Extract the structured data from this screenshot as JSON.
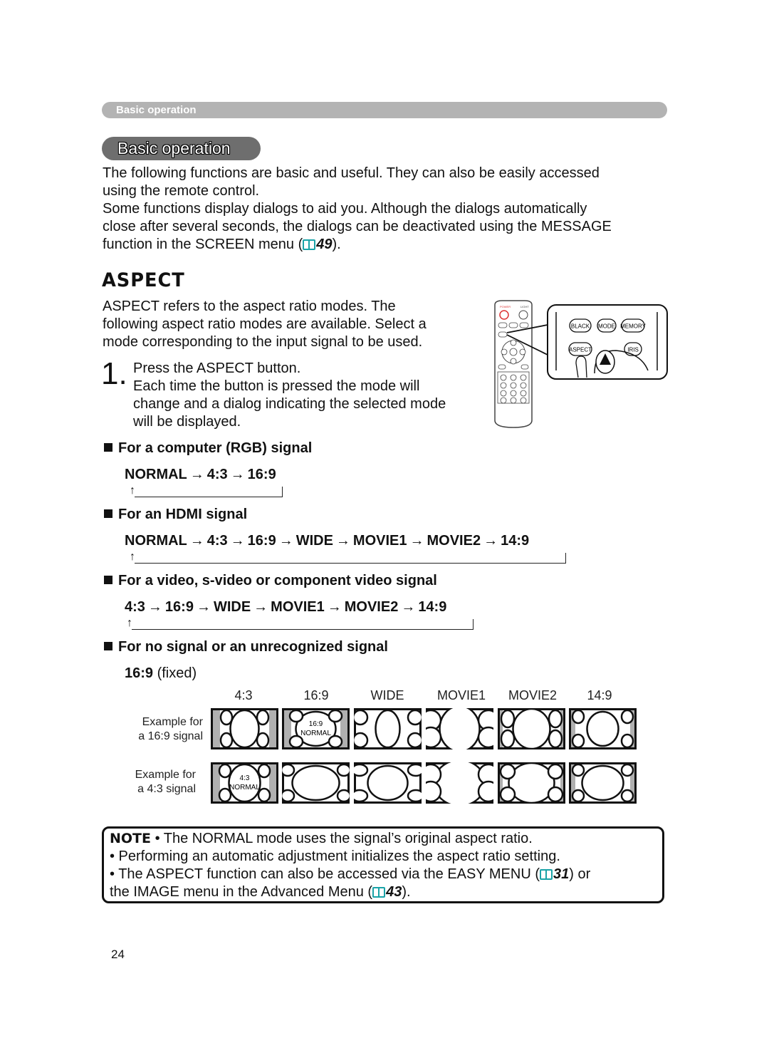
{
  "header": {
    "running_title": "Basic operation"
  },
  "section": {
    "title": "Basic operation",
    "intro_line1": "The following functions are basic and useful. They can also be easily accessed",
    "intro_line2": "using the remote control.",
    "intro_line3": "Some functions display dialogs to aid you. Although the dialogs automatically",
    "intro_line4": "close after several seconds, the dialogs can be deactivated using the MESSAGE",
    "intro_line5_prefix": "function in the SCREEN menu (",
    "intro_line5_ref": "49",
    "intro_line5_suffix": ")."
  },
  "aspect": {
    "heading": "ASPECT",
    "desc_line1": "ASPECT refers to the aspect ratio modes. The",
    "desc_line2": "following aspect ratio modes are available. Select a",
    "desc_line3": "mode corresponding to the input signal to be used.",
    "step_number": "1.",
    "step_line1": "Press the ASPECT button.",
    "step_line2": "Each time the button is pressed the mode will",
    "step_line3": "change and a dialog indicating the selected mode",
    "step_line4": "will be displayed."
  },
  "remote": {
    "power_label": "POWER",
    "light_label": "LIGHT",
    "callout_buttons": [
      "BLACK",
      "MODE",
      "MEMORY",
      "ASPECT",
      "IRIS"
    ]
  },
  "signals": [
    {
      "heading": "For a computer (RGB) signal",
      "sequence": [
        "NORMAL",
        "4:3",
        "16:9"
      ]
    },
    {
      "heading": "For an HDMI signal",
      "sequence": [
        "NORMAL",
        "4:3",
        "16:9",
        "WIDE",
        "MOVIE1",
        "MOVIE2",
        "14:9"
      ]
    },
    {
      "heading": "For a video, s-video or component video signal",
      "sequence": [
        "4:3",
        "16:9",
        "WIDE",
        "MOVIE1",
        "MOVIE2",
        "14:9"
      ]
    },
    {
      "heading": "For no signal or an unrecognized signal",
      "fixed_value": "16:9",
      "fixed_suffix": "(fixed)"
    }
  ],
  "arrow_glyph": "→",
  "loop_arrow_glyph": "↑",
  "examples": {
    "columns": [
      "4:3",
      "16:9",
      "WIDE",
      "MOVIE1",
      "MOVIE2",
      "14:9"
    ],
    "rows": [
      {
        "label_line1": "Example for",
        "label_line2": "a 16:9 signal",
        "normal_index": 1,
        "normal_line1": "16:9",
        "normal_line2": "NORMAL"
      },
      {
        "label_line1": "Example for",
        "label_line2": "a 4:3 signal",
        "normal_index": 0,
        "normal_line1": "4:3",
        "normal_line2": "NORMAL"
      }
    ]
  },
  "note": {
    "label": "NOTE",
    "line1": "• The NORMAL mode uses the signal’s original aspect ratio.",
    "line2": "• Performing an automatic adjustment initializes the aspect ratio setting.",
    "line3_prefix": "• The ASPECT function can also be accessed via the EASY MENU (",
    "line3_ref": "31",
    "line3_suffix": ") or",
    "line4_prefix": "the IMAGE menu in the Advanced Menu (",
    "line4_ref": "43",
    "line4_suffix": ")."
  },
  "page_number": "24",
  "colors": {
    "header_bar": "#b3b3b3",
    "section_pill": "#6e6e6e",
    "ref_icon": "#1aa3a8",
    "letterbox": "#b0b0b0"
  }
}
